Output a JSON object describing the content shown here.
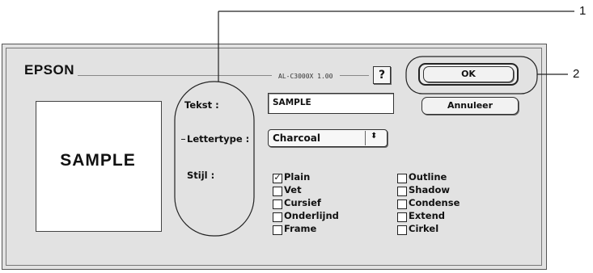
{
  "dialog": {
    "brand": "EPSON",
    "version": "AL-C3000X 1.00",
    "help_label": "?",
    "preview_text": "SAMPLE"
  },
  "form": {
    "tekst_label": "Tekst :",
    "tekst_value": "SAMPLE",
    "lettertype_label": "Lettertype :",
    "lettertype_value": "Charcoal",
    "lettertype_arrow": "⬍",
    "stijl_label": "Stijl :"
  },
  "styles": {
    "col1": [
      {
        "label": "Plain",
        "checked": true
      },
      {
        "label": "Vet",
        "checked": false
      },
      {
        "label": "Cursief",
        "checked": false
      },
      {
        "label": "Onderlijnd",
        "checked": false
      },
      {
        "label": "Frame",
        "checked": false
      }
    ],
    "col2": [
      {
        "label": "Outline",
        "checked": false
      },
      {
        "label": "Shadow",
        "checked": false
      },
      {
        "label": "Condense",
        "checked": false
      },
      {
        "label": "Extend",
        "checked": false
      },
      {
        "label": "Cirkel",
        "checked": false
      }
    ],
    "check_mark": "✓"
  },
  "buttons": {
    "ok": "OK",
    "cancel": "Annuleer"
  },
  "callouts": {
    "one": "1",
    "two": "2"
  }
}
